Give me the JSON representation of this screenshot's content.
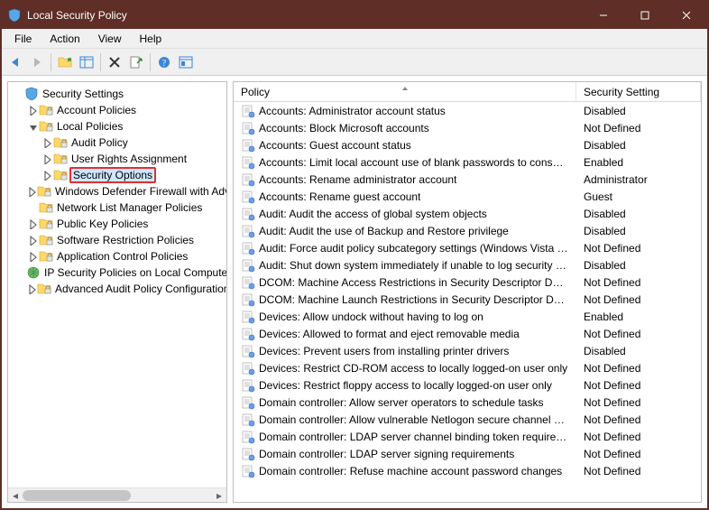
{
  "window": {
    "title": "Local Security Policy"
  },
  "menubar": [
    "File",
    "Action",
    "View",
    "Help"
  ],
  "tree": {
    "root": {
      "label": "Security Settings"
    },
    "items": [
      {
        "label": "Account Policies",
        "expand": "closed",
        "depth": 1
      },
      {
        "label": "Local Policies",
        "expand": "open",
        "depth": 1
      },
      {
        "label": "Audit Policy",
        "expand": "closed",
        "depth": 2
      },
      {
        "label": "User Rights Assignment",
        "expand": "closed",
        "depth": 2
      },
      {
        "label": "Security Options",
        "expand": "closed",
        "depth": 2,
        "selected": true
      },
      {
        "label": "Windows Defender Firewall with Advanced Security",
        "expand": "closed",
        "depth": 1
      },
      {
        "label": "Network List Manager Policies",
        "expand": "none",
        "depth": 1
      },
      {
        "label": "Public Key Policies",
        "expand": "closed",
        "depth": 1
      },
      {
        "label": "Software Restriction Policies",
        "expand": "closed",
        "depth": 1
      },
      {
        "label": "Application Control Policies",
        "expand": "closed",
        "depth": 1
      },
      {
        "label": "IP Security Policies on Local Computer",
        "expand": "none",
        "depth": 1,
        "icon": "ipsec"
      },
      {
        "label": "Advanced Audit Policy Configuration",
        "expand": "closed",
        "depth": 1
      }
    ]
  },
  "list": {
    "columns": {
      "policy": "Policy",
      "setting": "Security Setting"
    },
    "rows": [
      {
        "policy": "Accounts: Administrator account status",
        "setting": "Disabled"
      },
      {
        "policy": "Accounts: Block Microsoft accounts",
        "setting": "Not Defined"
      },
      {
        "policy": "Accounts: Guest account status",
        "setting": "Disabled"
      },
      {
        "policy": "Accounts: Limit local account use of blank passwords to console logon only",
        "setting": "Enabled"
      },
      {
        "policy": "Accounts: Rename administrator account",
        "setting": "Administrator"
      },
      {
        "policy": "Accounts: Rename guest account",
        "setting": "Guest"
      },
      {
        "policy": "Audit: Audit the access of global system objects",
        "setting": "Disabled"
      },
      {
        "policy": "Audit: Audit the use of Backup and Restore privilege",
        "setting": "Disabled"
      },
      {
        "policy": "Audit: Force audit policy subcategory settings (Windows Vista or later) to override audit policy category settings",
        "setting": "Not Defined"
      },
      {
        "policy": "Audit: Shut down system immediately if unable to log security audits",
        "setting": "Disabled"
      },
      {
        "policy": "DCOM: Machine Access Restrictions in Security Descriptor Definition Language (SDDL) syntax",
        "setting": "Not Defined"
      },
      {
        "policy": "DCOM: Machine Launch Restrictions in Security Descriptor Definition Language (SDDL) syntax",
        "setting": "Not Defined"
      },
      {
        "policy": "Devices: Allow undock without having to log on",
        "setting": "Enabled"
      },
      {
        "policy": "Devices: Allowed to format and eject removable media",
        "setting": "Not Defined"
      },
      {
        "policy": "Devices: Prevent users from installing printer drivers",
        "setting": "Disabled"
      },
      {
        "policy": "Devices: Restrict CD-ROM access to locally logged-on user only",
        "setting": "Not Defined"
      },
      {
        "policy": "Devices: Restrict floppy access to locally logged-on user only",
        "setting": "Not Defined"
      },
      {
        "policy": "Domain controller: Allow server operators to schedule tasks",
        "setting": "Not Defined"
      },
      {
        "policy": "Domain controller: Allow vulnerable Netlogon secure channel connections",
        "setting": "Not Defined"
      },
      {
        "policy": "Domain controller: LDAP server channel binding token requirements",
        "setting": "Not Defined"
      },
      {
        "policy": "Domain controller: LDAP server signing requirements",
        "setting": "Not Defined"
      },
      {
        "policy": "Domain controller: Refuse machine account password changes",
        "setting": "Not Defined"
      }
    ]
  }
}
